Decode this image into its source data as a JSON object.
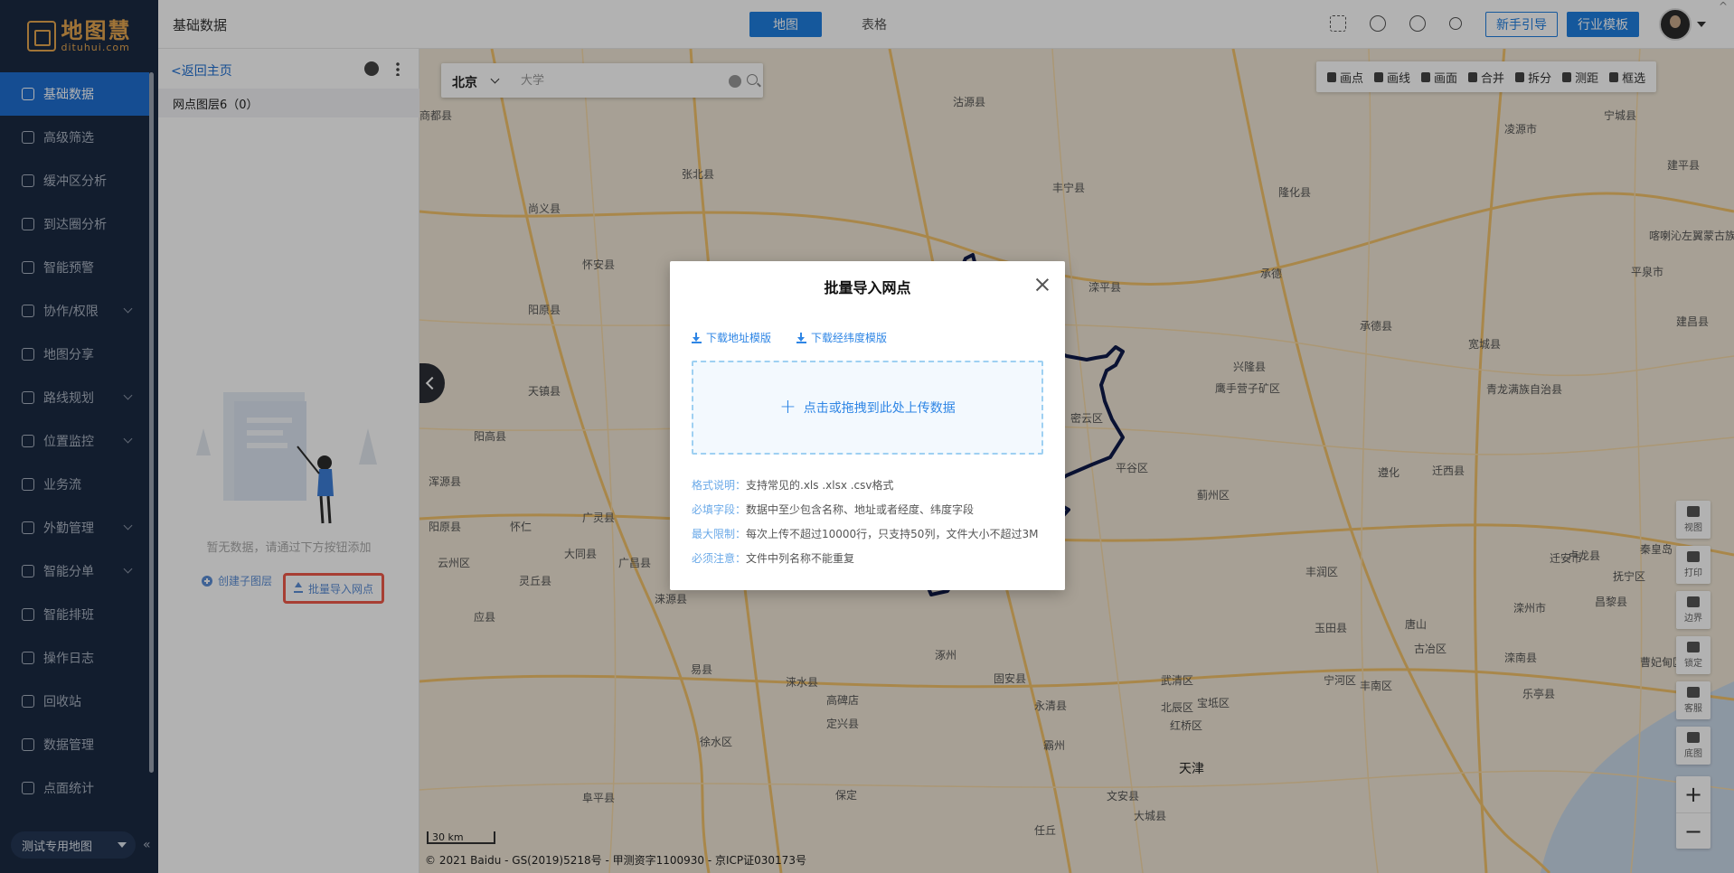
{
  "app": {
    "logo_cn": "地图慧",
    "logo_en": "dituhui.com"
  },
  "nav": {
    "items": [
      {
        "label": "基础数据",
        "active": true,
        "has_children": false,
        "icon": "table-icon"
      },
      {
        "label": "高级筛选",
        "active": false,
        "has_children": false,
        "icon": "filter-icon"
      },
      {
        "label": "缓冲区分析",
        "active": false,
        "has_children": false,
        "icon": "target-icon"
      },
      {
        "label": "到达圈分析",
        "active": false,
        "has_children": false,
        "icon": "circle-icon"
      },
      {
        "label": "智能预警",
        "active": false,
        "has_children": false,
        "icon": "alert-icon"
      },
      {
        "label": "协作/权限",
        "active": false,
        "has_children": true,
        "icon": "users-icon"
      },
      {
        "label": "地图分享",
        "active": false,
        "has_children": false,
        "icon": "share-icon"
      },
      {
        "label": "路线规划",
        "active": false,
        "has_children": true,
        "icon": "route-icon"
      },
      {
        "label": "位置监控",
        "active": false,
        "has_children": true,
        "icon": "location-icon"
      },
      {
        "label": "业务流",
        "active": false,
        "has_children": false,
        "icon": "flow-icon"
      },
      {
        "label": "外勤管理",
        "active": false,
        "has_children": true,
        "icon": "field-icon"
      },
      {
        "label": "智能分单",
        "active": false,
        "has_children": true,
        "icon": "dispatch-icon"
      },
      {
        "label": "智能排班",
        "active": false,
        "has_children": false,
        "icon": "calendar-icon"
      },
      {
        "label": "操作日志",
        "active": false,
        "has_children": false,
        "icon": "log-icon"
      },
      {
        "label": "回收站",
        "active": false,
        "has_children": false,
        "icon": "trash-icon"
      },
      {
        "label": "数据管理",
        "active": false,
        "has_children": false,
        "icon": "database-icon"
      },
      {
        "label": "点面统计",
        "active": false,
        "has_children": false,
        "icon": "stats-icon"
      }
    ],
    "map_select": "测试专用地图",
    "collapse": "«"
  },
  "header": {
    "title": "基础数据",
    "tabs": [
      {
        "label": "地图",
        "active": true
      },
      {
        "label": "表格",
        "active": false
      }
    ],
    "guide_button": "新手引导",
    "industry_button": "行业模板",
    "icons": [
      "fullscreen-icon",
      "headset-icon",
      "help-icon",
      "share-icon"
    ],
    "collapse_top": "^"
  },
  "panel": {
    "back": "<返回主页",
    "layer_name": "网点图层6（0）",
    "empty_text": "暂无数据，请通过下方按钮添加",
    "create_sublayer": "创建子图层",
    "batch_import": "批量导入网点"
  },
  "map": {
    "search": {
      "city": "北京",
      "placeholder": "大学"
    },
    "toolbar": [
      "画点",
      "画线",
      "画面",
      "合并",
      "拆分",
      "测距",
      "框选"
    ],
    "right_tools": [
      "视图",
      "打印",
      "边界",
      "锁定",
      "客服",
      "底图"
    ],
    "zoom_in": "+",
    "zoom_out": "−",
    "scale": "30 km",
    "copyright": "© 2021 Baidu - GS(2019)5218号 - 甲测资字1100930 - 京ICP证030173号",
    "places": [
      {
        "name": "沽源县"
      },
      {
        "name": "丰宁县"
      },
      {
        "name": "隆化县"
      },
      {
        "name": "宁城县"
      },
      {
        "name": "建平县"
      },
      {
        "name": "商都县"
      },
      {
        "name": "张北县"
      },
      {
        "name": "尚义县"
      },
      {
        "name": "凌源市"
      },
      {
        "name": "承德"
      },
      {
        "name": "滦平县"
      },
      {
        "name": "平泉市"
      },
      {
        "name": "喀喇沁左翼蒙古族自治县"
      },
      {
        "name": "建昌县"
      },
      {
        "name": "承德县"
      },
      {
        "name": "宽城县"
      },
      {
        "name": "兴隆县"
      },
      {
        "name": "鹰手营子矿区"
      },
      {
        "name": "青龙满族自治县"
      },
      {
        "name": "阳原县"
      },
      {
        "name": "怀安县"
      },
      {
        "name": "天镇县"
      },
      {
        "name": "迁西县"
      },
      {
        "name": "遵化"
      },
      {
        "name": "蓟州区"
      },
      {
        "name": "平谷区"
      },
      {
        "name": "密云区"
      },
      {
        "name": "阳高县"
      },
      {
        "name": "阳原县"
      },
      {
        "name": "广灵县"
      },
      {
        "name": "涞源县"
      },
      {
        "name": "灵丘县"
      },
      {
        "name": "易县"
      },
      {
        "name": "涿州"
      },
      {
        "name": "固安县"
      },
      {
        "name": "永清县"
      },
      {
        "name": "霸州"
      },
      {
        "name": "高碑店"
      },
      {
        "name": "定兴县"
      },
      {
        "name": "涞水县"
      },
      {
        "name": "武清区"
      },
      {
        "name": "宝坻区"
      },
      {
        "name": "唐山"
      },
      {
        "name": "丰润区"
      },
      {
        "name": "玉田县"
      },
      {
        "name": "古冶区"
      },
      {
        "name": "滦州市"
      },
      {
        "name": "迁安市"
      },
      {
        "name": "卢龙县"
      },
      {
        "name": "抚宁区"
      },
      {
        "name": "秦皇岛"
      },
      {
        "name": "昌黎县"
      },
      {
        "name": "滦南县"
      },
      {
        "name": "乐亭县"
      },
      {
        "name": "丰南区"
      },
      {
        "name": "曹妃甸区"
      },
      {
        "name": "宁河区"
      },
      {
        "name": "北辰区"
      },
      {
        "name": "红桥区"
      },
      {
        "name": "天津"
      },
      {
        "name": "保定"
      },
      {
        "name": "文安县"
      },
      {
        "name": "大城县"
      },
      {
        "name": "任丘"
      },
      {
        "name": "徐水区"
      },
      {
        "name": "阜平县"
      },
      {
        "name": "浑源县"
      },
      {
        "name": "应县"
      },
      {
        "name": "怀仁"
      },
      {
        "name": "大同县"
      },
      {
        "name": "云州区"
      },
      {
        "name": "广昌县"
      }
    ]
  },
  "modal": {
    "title": "批量导入网点",
    "link_address": "下载地址模版",
    "link_latlng": "下载经纬度模版",
    "dropzone": "点击或拖拽到此处上传数据",
    "notes": [
      {
        "label": "格式说明：",
        "value": "支持常见的.xls .xlsx .csv格式"
      },
      {
        "label": "必填字段：",
        "value": "数据中至少包含名称、地址或者经度、纬度字段"
      },
      {
        "label": "最大限制：",
        "value": "每次上传不超过10000行，只支持50列，文件大小不超过3M"
      },
      {
        "label": "必须注意：",
        "value": "文件中列名称不能重复"
      }
    ]
  },
  "colors": {
    "nav_bg": "#1b2a43",
    "accent": "#1f7ee0",
    "highlight": "#ef5a4a",
    "map_bg": "#efe6d6"
  }
}
